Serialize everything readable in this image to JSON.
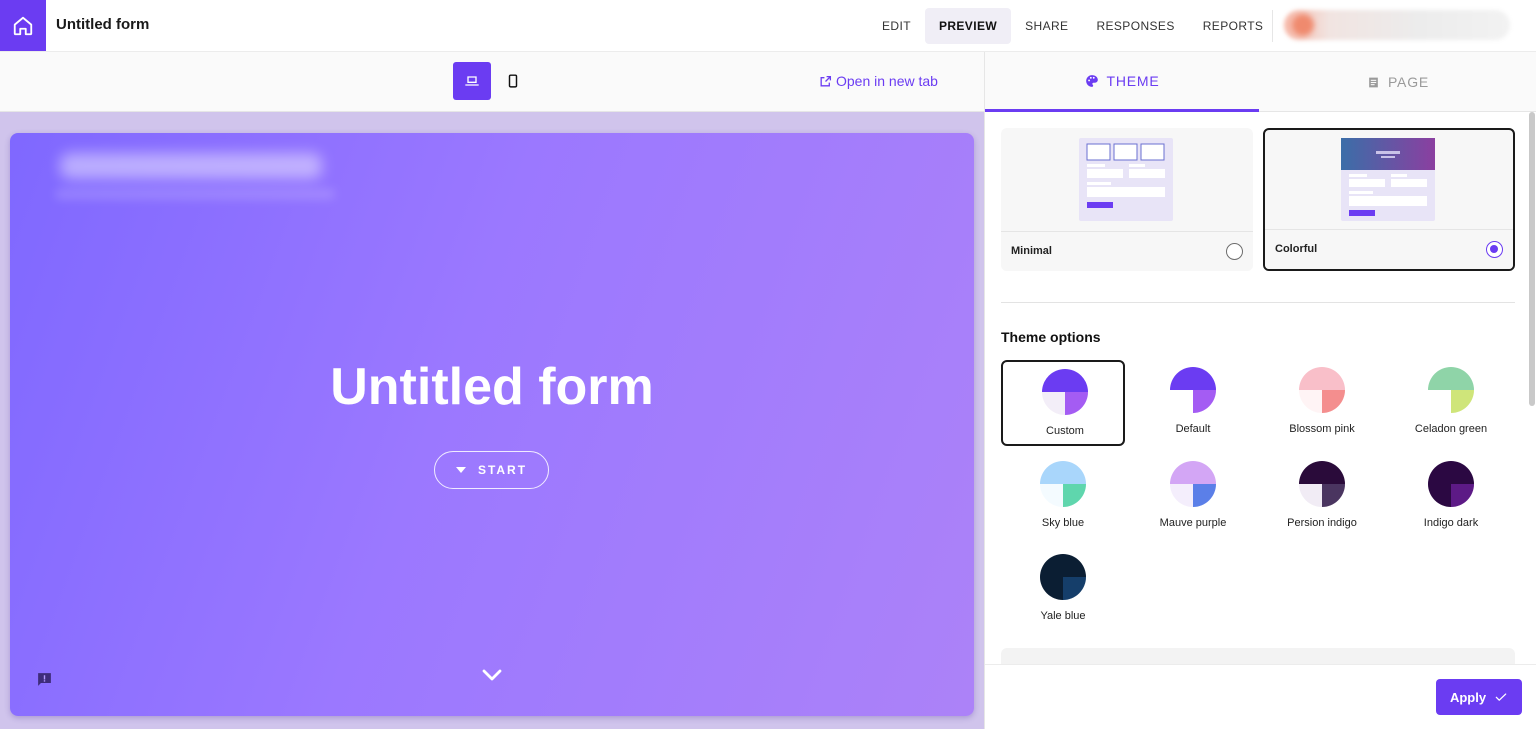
{
  "header": {
    "title": "Untitled form",
    "nav": [
      "EDIT",
      "PREVIEW",
      "SHARE",
      "RESPONSES",
      "REPORTS"
    ],
    "active_nav": "PREVIEW",
    "brand_color": "#6b3cf2"
  },
  "preview": {
    "open_in_new_tab": "Open in new tab",
    "form_title": "Untitled form",
    "start_label": "START",
    "device_selected": "desktop"
  },
  "panel": {
    "tabs": {
      "theme": "THEME",
      "page": "PAGE"
    },
    "active_tab": "THEME",
    "templates": [
      {
        "label": "Minimal",
        "selected": false
      },
      {
        "label": "Colorful",
        "selected": true
      }
    ],
    "theme_options_heading": "Theme options",
    "theme_options": [
      {
        "label": "Custom",
        "selected": true,
        "top": "#6b3cf2",
        "bl": "#f3eef8",
        "br": "#a45cf3"
      },
      {
        "label": "Default",
        "selected": false,
        "top": "#6b3cf2",
        "bl": "#ffffff",
        "br": "#a45cf3"
      },
      {
        "label": "Blossom pink",
        "selected": false,
        "top": "#f9bfc9",
        "bl": "#fff4f5",
        "br": "#f48e8e"
      },
      {
        "label": "Celadon green",
        "selected": false,
        "top": "#8fd4a8",
        "bl": "#ffffff",
        "br": "#cfe57a"
      },
      {
        "label": "Sky blue",
        "selected": false,
        "top": "#a9d6fb",
        "bl": "#f4fbff",
        "br": "#5fd6ad"
      },
      {
        "label": "Mauve purple",
        "selected": false,
        "top": "#d3a6f5",
        "bl": "#f4eefc",
        "br": "#5b7fe8"
      },
      {
        "label": "Persion indigo",
        "selected": false,
        "top": "#2a0b3a",
        "bl": "#f1ecf5",
        "br": "#4a3560"
      },
      {
        "label": "Indigo dark",
        "selected": false,
        "top": "#2b0842",
        "bl": "#2b0842",
        "br": "#5d1a86"
      },
      {
        "label": "Yale blue",
        "selected": false,
        "top": "#0b1e33",
        "bl": "#0b1e33",
        "br": "#153e6a"
      }
    ],
    "apply_label": "Apply"
  }
}
